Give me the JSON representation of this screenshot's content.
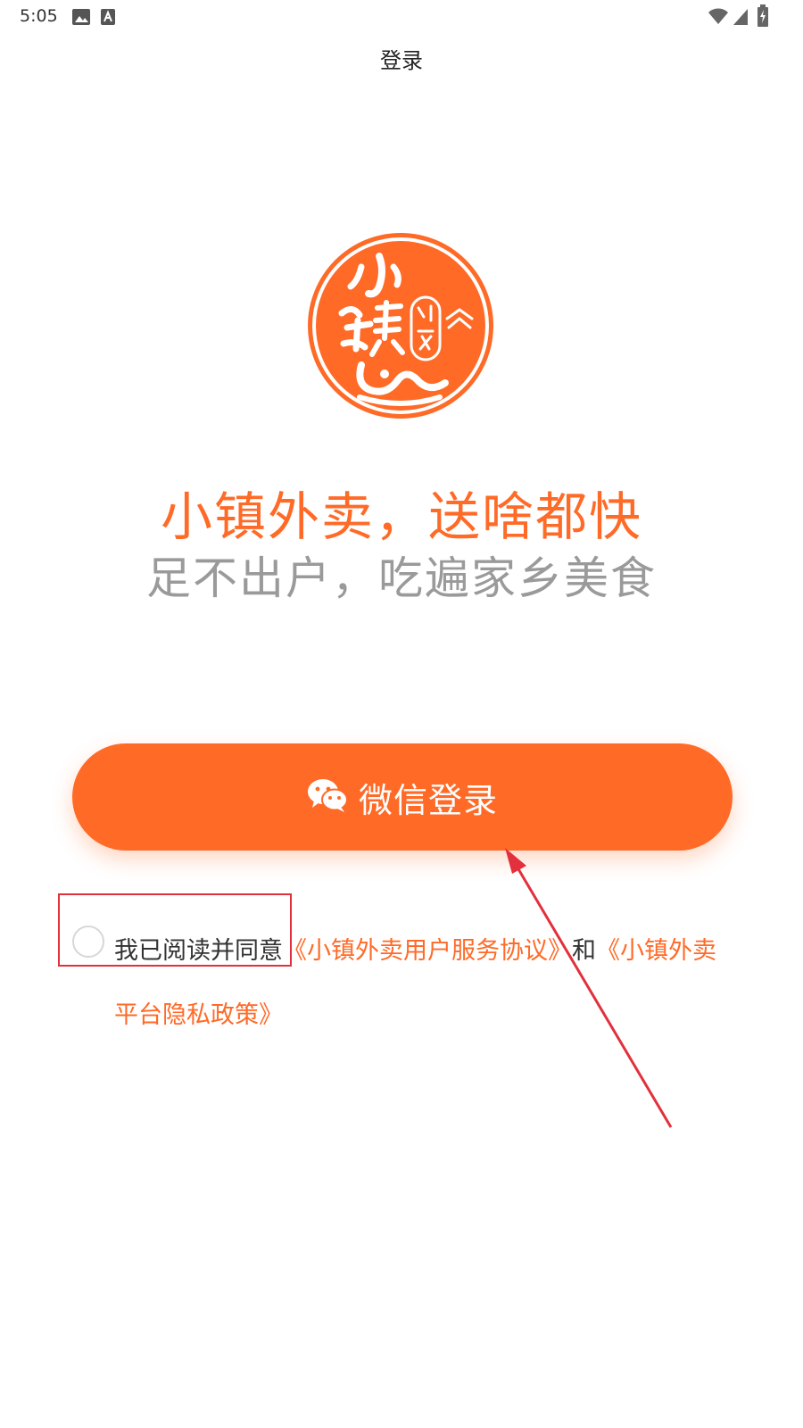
{
  "status_bar": {
    "time": "5:05",
    "icons": [
      "image-icon",
      "text-a-icon",
      "wifi-icon",
      "signal-icon",
      "battery-icon"
    ]
  },
  "nav": {
    "title": "登录"
  },
  "logo": {
    "icon": "xiaozhen-waimai-logo"
  },
  "slogan": {
    "primary": "小镇外卖，送啥都快",
    "secondary": "足不出户，吃遍家乡美食"
  },
  "login": {
    "button_label": "微信登录",
    "icon": "wechat-icon"
  },
  "agreement": {
    "prefix": "我已阅读并同意",
    "service_link": "《小镇外卖用户服务协议》",
    "connector": "和",
    "privacy_link": "《小镇外卖平台隐私政策》"
  },
  "colors": {
    "accent": "#ff6a27",
    "secondary_text": "#9a9a9a",
    "annotation": "#e2303c"
  }
}
